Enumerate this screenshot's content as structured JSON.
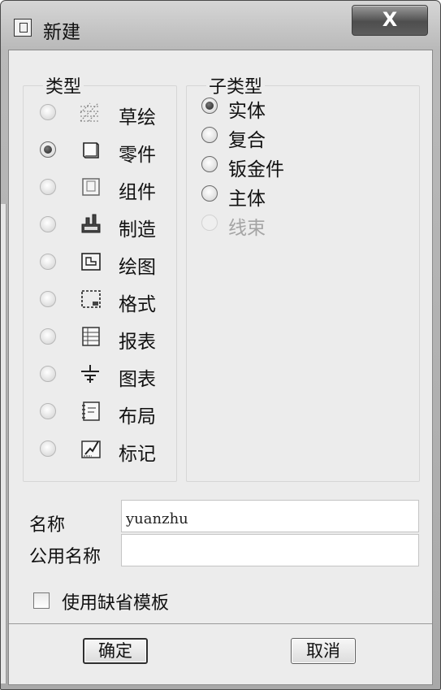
{
  "window": {
    "title": "新建",
    "close_label": "X"
  },
  "type_group": {
    "label": "类型",
    "items": [
      {
        "label": "草绘",
        "icon": "sketch-icon",
        "checked": false
      },
      {
        "label": "零件",
        "icon": "part-icon",
        "checked": true
      },
      {
        "label": "组件",
        "icon": "assembly-icon",
        "checked": false
      },
      {
        "label": "制造",
        "icon": "manufacturing-icon",
        "checked": false
      },
      {
        "label": "绘图",
        "icon": "drawing-icon",
        "checked": false
      },
      {
        "label": "格式",
        "icon": "format-icon",
        "checked": false
      },
      {
        "label": "报表",
        "icon": "report-icon",
        "checked": false
      },
      {
        "label": "图表",
        "icon": "diagram-icon",
        "checked": false
      },
      {
        "label": "布局",
        "icon": "layout-icon",
        "checked": false
      },
      {
        "label": "标记",
        "icon": "markup-icon",
        "checked": false
      }
    ]
  },
  "subtype_group": {
    "label": "子类型",
    "items": [
      {
        "label": "实体",
        "checked": true,
        "enabled": true
      },
      {
        "label": "复合",
        "checked": false,
        "enabled": true
      },
      {
        "label": "钣金件",
        "checked": false,
        "enabled": true
      },
      {
        "label": "主体",
        "checked": false,
        "enabled": true
      },
      {
        "label": "线束",
        "checked": false,
        "enabled": false
      }
    ]
  },
  "form": {
    "name_label": "名称",
    "name_value": "yuanzhu",
    "common_name_label": "公用名称",
    "common_name_value": "",
    "use_default_template_label": "使用缺省模板",
    "use_default_template_checked": false
  },
  "buttons": {
    "ok_label": "确定",
    "cancel_label": "取消"
  }
}
